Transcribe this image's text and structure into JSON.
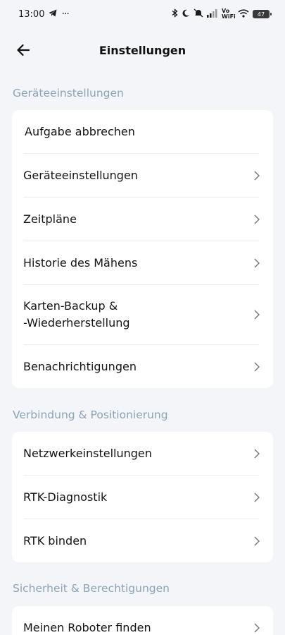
{
  "status": {
    "time": "13:00",
    "dots": "···",
    "network": "Vo WiFi",
    "battery": "47"
  },
  "header": {
    "title": "Einstellungen"
  },
  "sections": [
    {
      "title": "Geräteeinstellungen",
      "items": [
        {
          "label": "Aufgabe abbrechen",
          "chevron": false
        },
        {
          "label": "Geräteeinstellungen",
          "chevron": true
        },
        {
          "label": "Zeitpläne",
          "chevron": true
        },
        {
          "label": "Historie des Mähens",
          "chevron": true
        },
        {
          "label": "Karten-Backup &\n-Wiederherstellung",
          "chevron": true
        },
        {
          "label": "Benachrichtigungen",
          "chevron": true
        }
      ]
    },
    {
      "title": "Verbindung & Positionierung",
      "items": [
        {
          "label": "Netzwerkeinstellungen",
          "chevron": true
        },
        {
          "label": "RTK-Diagnostik",
          "chevron": true
        },
        {
          "label": "RTK binden",
          "chevron": true
        }
      ]
    },
    {
      "title": "Sicherheit & Berechtigungen",
      "items": [
        {
          "label": "Meinen Roboter finden",
          "chevron": true
        }
      ]
    }
  ]
}
